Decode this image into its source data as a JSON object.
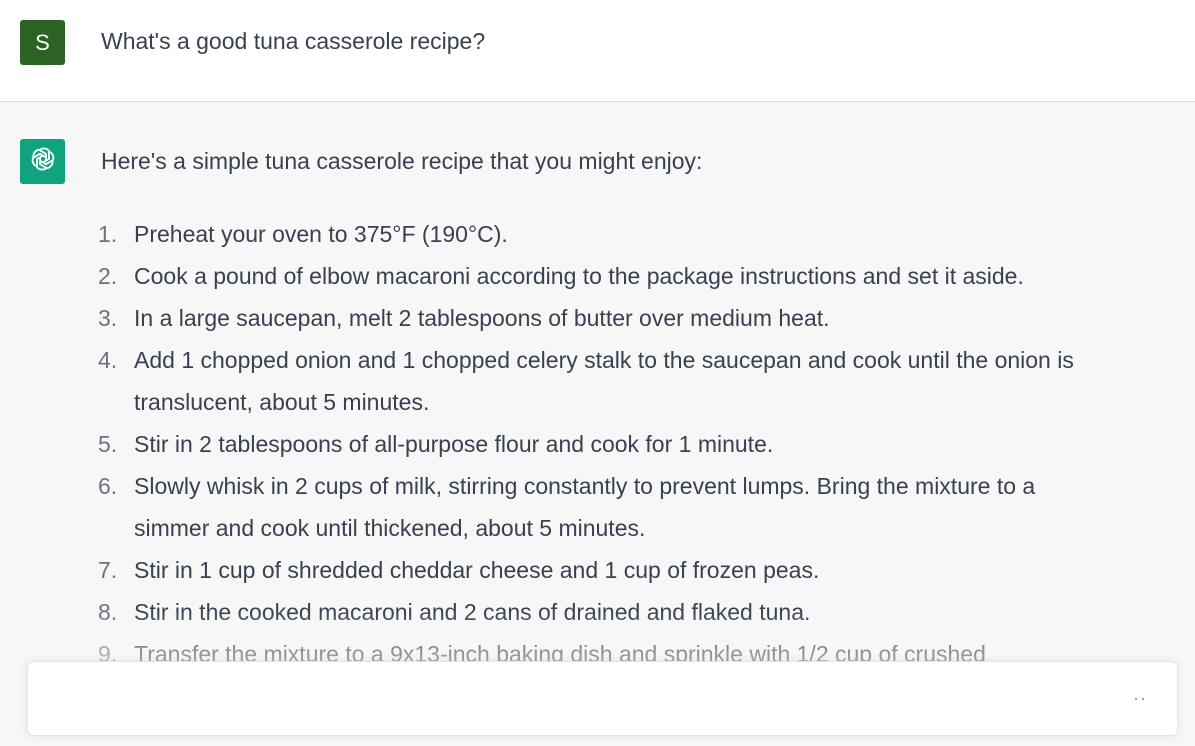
{
  "user": {
    "avatar_letter": "S",
    "message": "What's a good tuna casserole recipe?"
  },
  "assistant": {
    "avatar_icon": "openai-logo-icon",
    "intro": "Here's a simple tuna casserole recipe that you might enjoy:",
    "steps": [
      {
        "number": "1.",
        "text": "Preheat your oven to 375°F (190°C)."
      },
      {
        "number": "2.",
        "text": "Cook a pound of elbow macaroni according to the package instructions and set it aside."
      },
      {
        "number": "3.",
        "text": "In a large saucepan, melt 2 tablespoons of butter over medium heat."
      },
      {
        "number": "4.",
        "text": "Add 1 chopped onion and 1 chopped celery stalk to the saucepan and cook until the onion is translucent, about 5 minutes."
      },
      {
        "number": "5.",
        "text": "Stir in 2 tablespoons of all-purpose flour and cook for 1 minute."
      },
      {
        "number": "6.",
        "text": "Slowly whisk in 2 cups of milk, stirring constantly to prevent lumps. Bring the mixture to a simmer and cook until thickened, about 5 minutes."
      },
      {
        "number": "7.",
        "text": "Stir in 1 cup of shredded cheddar cheese and 1 cup of frozen peas."
      },
      {
        "number": "8.",
        "text": "Stir in the cooked macaroni and 2 cans of drained and flaked tuna."
      },
      {
        "number": "9.",
        "text": "Transfer the mixture to a 9x13-inch baking dish and sprinkle with 1/2 cup of crushed"
      }
    ]
  },
  "composer": {
    "status_indicator": "··"
  },
  "colors": {
    "user_avatar_bg": "#2b6322",
    "assistant_avatar_bg": "#10a37f",
    "assistant_bg": "#f7f7f8",
    "user_bg": "#ffffff",
    "text": "#374151"
  }
}
